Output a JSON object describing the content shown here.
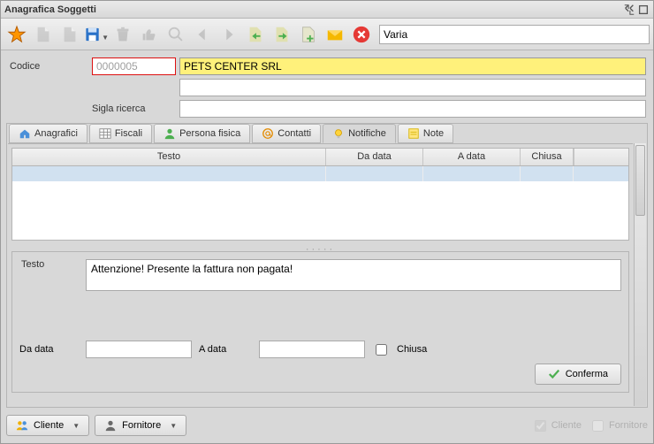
{
  "window": {
    "title": "Anagrafica Soggetti"
  },
  "toolbar": {
    "mode": "Varia"
  },
  "fields": {
    "code_label": "Codice",
    "code_value": "0000005",
    "name_value": "PETS CENTER SRL",
    "extra_value": "",
    "search_label": "Sigla ricerca",
    "search_value": ""
  },
  "tabs": {
    "anagrafici": "Anagrafici",
    "fiscali": "Fiscali",
    "persona": "Persona fisica",
    "contatti": "Contatti",
    "notifiche": "Notifiche",
    "note": "Note"
  },
  "table": {
    "col_testo": "Testo",
    "col_da_data": "Da data",
    "col_a_data": "A data",
    "col_chiusa": "Chiusa"
  },
  "form": {
    "testo_label": "Testo",
    "testo_value": "Attenzione! Presente la fattura non pagata!",
    "da_label": "Da data",
    "da_value": "",
    "a_label": "A data",
    "a_value": "",
    "chiusa_label": "Chiusa",
    "confirm": "Conferma"
  },
  "footer": {
    "cliente_btn": "Cliente",
    "fornitore_btn": "Fornitore",
    "cliente_chk": "Cliente",
    "fornitore_chk": "Fornitore"
  }
}
